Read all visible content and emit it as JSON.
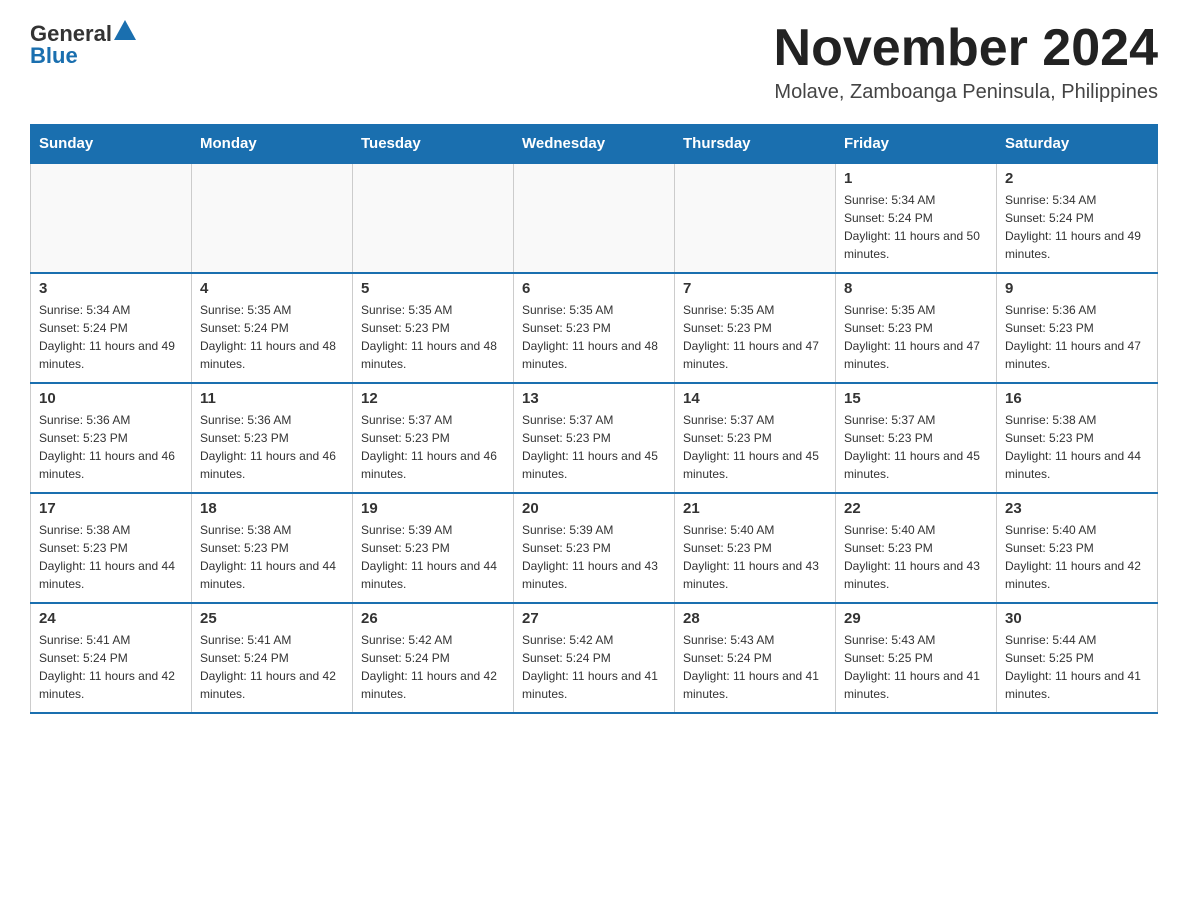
{
  "header": {
    "logo_general": "General",
    "logo_blue": "Blue",
    "month_title": "November 2024",
    "location": "Molave, Zamboanga Peninsula, Philippines"
  },
  "days_of_week": [
    "Sunday",
    "Monday",
    "Tuesday",
    "Wednesday",
    "Thursday",
    "Friday",
    "Saturday"
  ],
  "weeks": [
    [
      {
        "day": "",
        "info": ""
      },
      {
        "day": "",
        "info": ""
      },
      {
        "day": "",
        "info": ""
      },
      {
        "day": "",
        "info": ""
      },
      {
        "day": "",
        "info": ""
      },
      {
        "day": "1",
        "info": "Sunrise: 5:34 AM\nSunset: 5:24 PM\nDaylight: 11 hours and 50 minutes."
      },
      {
        "day": "2",
        "info": "Sunrise: 5:34 AM\nSunset: 5:24 PM\nDaylight: 11 hours and 49 minutes."
      }
    ],
    [
      {
        "day": "3",
        "info": "Sunrise: 5:34 AM\nSunset: 5:24 PM\nDaylight: 11 hours and 49 minutes."
      },
      {
        "day": "4",
        "info": "Sunrise: 5:35 AM\nSunset: 5:24 PM\nDaylight: 11 hours and 48 minutes."
      },
      {
        "day": "5",
        "info": "Sunrise: 5:35 AM\nSunset: 5:23 PM\nDaylight: 11 hours and 48 minutes."
      },
      {
        "day": "6",
        "info": "Sunrise: 5:35 AM\nSunset: 5:23 PM\nDaylight: 11 hours and 48 minutes."
      },
      {
        "day": "7",
        "info": "Sunrise: 5:35 AM\nSunset: 5:23 PM\nDaylight: 11 hours and 47 minutes."
      },
      {
        "day": "8",
        "info": "Sunrise: 5:35 AM\nSunset: 5:23 PM\nDaylight: 11 hours and 47 minutes."
      },
      {
        "day": "9",
        "info": "Sunrise: 5:36 AM\nSunset: 5:23 PM\nDaylight: 11 hours and 47 minutes."
      }
    ],
    [
      {
        "day": "10",
        "info": "Sunrise: 5:36 AM\nSunset: 5:23 PM\nDaylight: 11 hours and 46 minutes."
      },
      {
        "day": "11",
        "info": "Sunrise: 5:36 AM\nSunset: 5:23 PM\nDaylight: 11 hours and 46 minutes."
      },
      {
        "day": "12",
        "info": "Sunrise: 5:37 AM\nSunset: 5:23 PM\nDaylight: 11 hours and 46 minutes."
      },
      {
        "day": "13",
        "info": "Sunrise: 5:37 AM\nSunset: 5:23 PM\nDaylight: 11 hours and 45 minutes."
      },
      {
        "day": "14",
        "info": "Sunrise: 5:37 AM\nSunset: 5:23 PM\nDaylight: 11 hours and 45 minutes."
      },
      {
        "day": "15",
        "info": "Sunrise: 5:37 AM\nSunset: 5:23 PM\nDaylight: 11 hours and 45 minutes."
      },
      {
        "day": "16",
        "info": "Sunrise: 5:38 AM\nSunset: 5:23 PM\nDaylight: 11 hours and 44 minutes."
      }
    ],
    [
      {
        "day": "17",
        "info": "Sunrise: 5:38 AM\nSunset: 5:23 PM\nDaylight: 11 hours and 44 minutes."
      },
      {
        "day": "18",
        "info": "Sunrise: 5:38 AM\nSunset: 5:23 PM\nDaylight: 11 hours and 44 minutes."
      },
      {
        "day": "19",
        "info": "Sunrise: 5:39 AM\nSunset: 5:23 PM\nDaylight: 11 hours and 44 minutes."
      },
      {
        "day": "20",
        "info": "Sunrise: 5:39 AM\nSunset: 5:23 PM\nDaylight: 11 hours and 43 minutes."
      },
      {
        "day": "21",
        "info": "Sunrise: 5:40 AM\nSunset: 5:23 PM\nDaylight: 11 hours and 43 minutes."
      },
      {
        "day": "22",
        "info": "Sunrise: 5:40 AM\nSunset: 5:23 PM\nDaylight: 11 hours and 43 minutes."
      },
      {
        "day": "23",
        "info": "Sunrise: 5:40 AM\nSunset: 5:23 PM\nDaylight: 11 hours and 42 minutes."
      }
    ],
    [
      {
        "day": "24",
        "info": "Sunrise: 5:41 AM\nSunset: 5:24 PM\nDaylight: 11 hours and 42 minutes."
      },
      {
        "day": "25",
        "info": "Sunrise: 5:41 AM\nSunset: 5:24 PM\nDaylight: 11 hours and 42 minutes."
      },
      {
        "day": "26",
        "info": "Sunrise: 5:42 AM\nSunset: 5:24 PM\nDaylight: 11 hours and 42 minutes."
      },
      {
        "day": "27",
        "info": "Sunrise: 5:42 AM\nSunset: 5:24 PM\nDaylight: 11 hours and 41 minutes."
      },
      {
        "day": "28",
        "info": "Sunrise: 5:43 AM\nSunset: 5:24 PM\nDaylight: 11 hours and 41 minutes."
      },
      {
        "day": "29",
        "info": "Sunrise: 5:43 AM\nSunset: 5:25 PM\nDaylight: 11 hours and 41 minutes."
      },
      {
        "day": "30",
        "info": "Sunrise: 5:44 AM\nSunset: 5:25 PM\nDaylight: 11 hours and 41 minutes."
      }
    ]
  ]
}
